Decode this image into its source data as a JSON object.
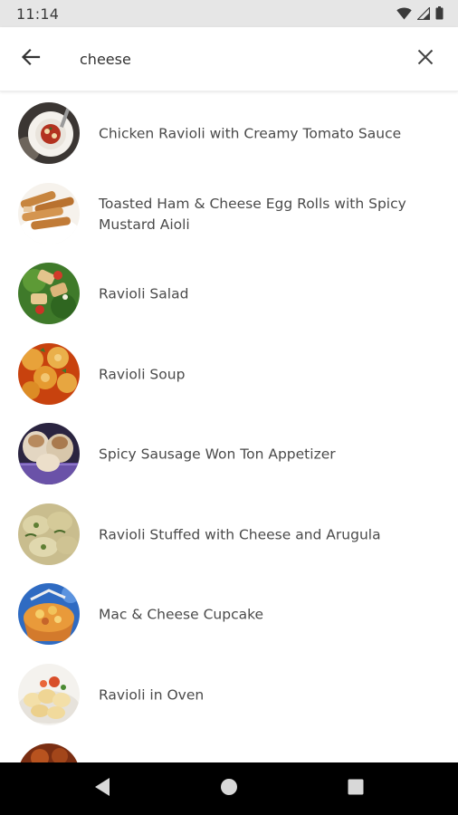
{
  "status_bar": {
    "time": "11:14",
    "icons": [
      "wifi-icon",
      "signal-icon",
      "battery-icon"
    ]
  },
  "search": {
    "query": "cheese",
    "back_icon": "arrow-left-icon",
    "clear_icon": "close-icon"
  },
  "results": [
    {
      "title": "Chicken Ravioli with Creamy Tomato Sauce",
      "thumb": "plated-ravioli"
    },
    {
      "title": "Toasted Ham & Cheese Egg Rolls with Spicy Mustard Aioli",
      "thumb": "egg-rolls"
    },
    {
      "title": "Ravioli Salad",
      "thumb": "salad"
    },
    {
      "title": "Ravioli Soup",
      "thumb": "soup"
    },
    {
      "title": "Spicy Sausage Won Ton Appetizer",
      "thumb": "won-ton"
    },
    {
      "title": "Ravioli Stuffed with Cheese and Arugula",
      "thumb": "stuffed-ravioli"
    },
    {
      "title": "Mac & Cheese Cupcake",
      "thumb": "mac-cupcake"
    },
    {
      "title": "Ravioli in Oven",
      "thumb": "oven-ravioli"
    },
    {
      "title": "",
      "thumb": "partial"
    }
  ],
  "nav_bar": {
    "icons": [
      "back-triangle-icon",
      "home-circle-icon",
      "recents-square-icon"
    ]
  }
}
